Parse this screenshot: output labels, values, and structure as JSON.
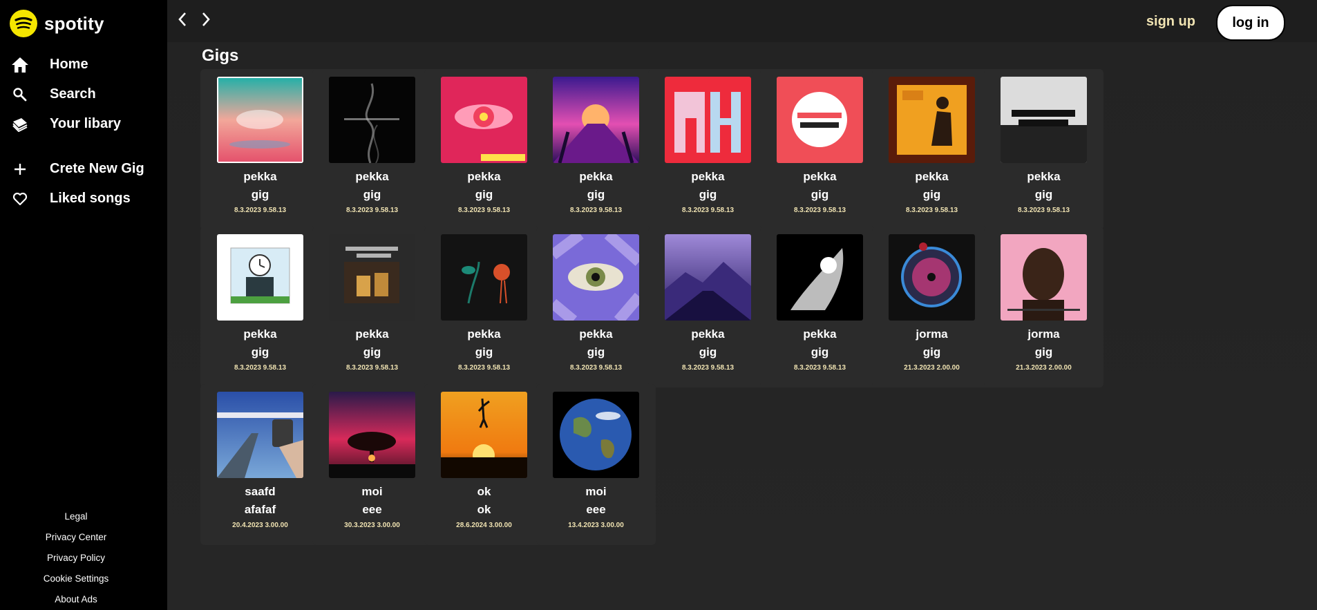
{
  "app": {
    "name": "spotity"
  },
  "nav": [
    {
      "icon": "home-icon",
      "label": "Home"
    },
    {
      "icon": "search-icon",
      "label": "Search"
    },
    {
      "icon": "library-icon",
      "label": "Your libary"
    },
    {
      "icon": "plus-icon",
      "label": "Crete New Gig"
    },
    {
      "icon": "heart-icon",
      "label": "Liked songs"
    }
  ],
  "footer": [
    "Legal",
    "Privacy Center",
    "Privacy Policy",
    "Cookie Settings",
    "About Ads"
  ],
  "topbar": {
    "signup": "sign up",
    "login": "log in"
  },
  "section": {
    "title": "Gigs"
  },
  "colors": {
    "accent": "#f5e600",
    "date_text": "#f0e3b2",
    "card_bg": "#2b2b2b"
  },
  "gigs": [
    {
      "artist": "pekka",
      "title": "gig",
      "date": "8.3.2023 9.58.13",
      "cover": "lake-sunset-album-cover"
    },
    {
      "artist": "pekka",
      "title": "gig",
      "date": "8.3.2023 9.58.13",
      "cover": "smoke-black-album-cover"
    },
    {
      "artist": "pekka",
      "title": "gig",
      "date": "8.3.2023 9.58.13",
      "cover": "pink-eye-album-cover"
    },
    {
      "artist": "pekka",
      "title": "gig",
      "date": "8.3.2023 9.58.13",
      "cover": "synthwave-palms-album-cover"
    },
    {
      "artist": "pekka",
      "title": "gig",
      "date": "8.3.2023 9.58.13",
      "cover": "rh-red-album-cover"
    },
    {
      "artist": "pekka",
      "title": "gig",
      "date": "8.3.2023 9.58.13",
      "cover": "retro-vibes-album-cover"
    },
    {
      "artist": "pekka",
      "title": "gig",
      "date": "8.3.2023 9.58.13",
      "cover": "orange-person-album-cover"
    },
    {
      "artist": "pekka",
      "title": "gig",
      "date": "8.3.2023 9.58.13",
      "cover": "thank-you-album-cover"
    },
    {
      "artist": "pekka",
      "title": "gig",
      "date": "8.3.2023 9.58.13",
      "cover": "clock-head-album-cover"
    },
    {
      "artist": "pekka",
      "title": "gig",
      "date": "8.3.2023 9.58.13",
      "cover": "lost-memories-album-cover"
    },
    {
      "artist": "pekka",
      "title": "gig",
      "date": "8.3.2023 9.58.13",
      "cover": "dark-flowers-album-cover"
    },
    {
      "artist": "pekka",
      "title": "gig",
      "date": "8.3.2023 9.58.13",
      "cover": "purple-eye-album-cover"
    },
    {
      "artist": "pekka",
      "title": "gig",
      "date": "8.3.2023 9.58.13",
      "cover": "sphere-mountain-album-cover"
    },
    {
      "artist": "pekka",
      "title": "gig",
      "date": "8.3.2023 9.58.13",
      "cover": "white-burst-album-cover"
    },
    {
      "artist": "jorma",
      "title": "gig",
      "date": "21.3.2023 2.00.00",
      "cover": "vinyl-disc-album-cover"
    },
    {
      "artist": "jorma",
      "title": "gig",
      "date": "21.3.2023 2.00.00",
      "cover": "pink-portrait-album-cover"
    },
    {
      "artist": "saafd",
      "title": "afafaf",
      "date": "20.4.2023 3.00.00",
      "cover": "highway-photo-album-cover"
    },
    {
      "artist": "moi",
      "title": "eee",
      "date": "30.3.2023 3.00.00",
      "cover": "red-tree-album-cover"
    },
    {
      "artist": "ok",
      "title": "ok",
      "date": "28.6.2024 3.00.00",
      "cover": "trampoline-sunset-album-cover"
    },
    {
      "artist": "moi",
      "title": "eee",
      "date": "13.4.2023 3.00.00",
      "cover": "earth-album-cover"
    }
  ]
}
